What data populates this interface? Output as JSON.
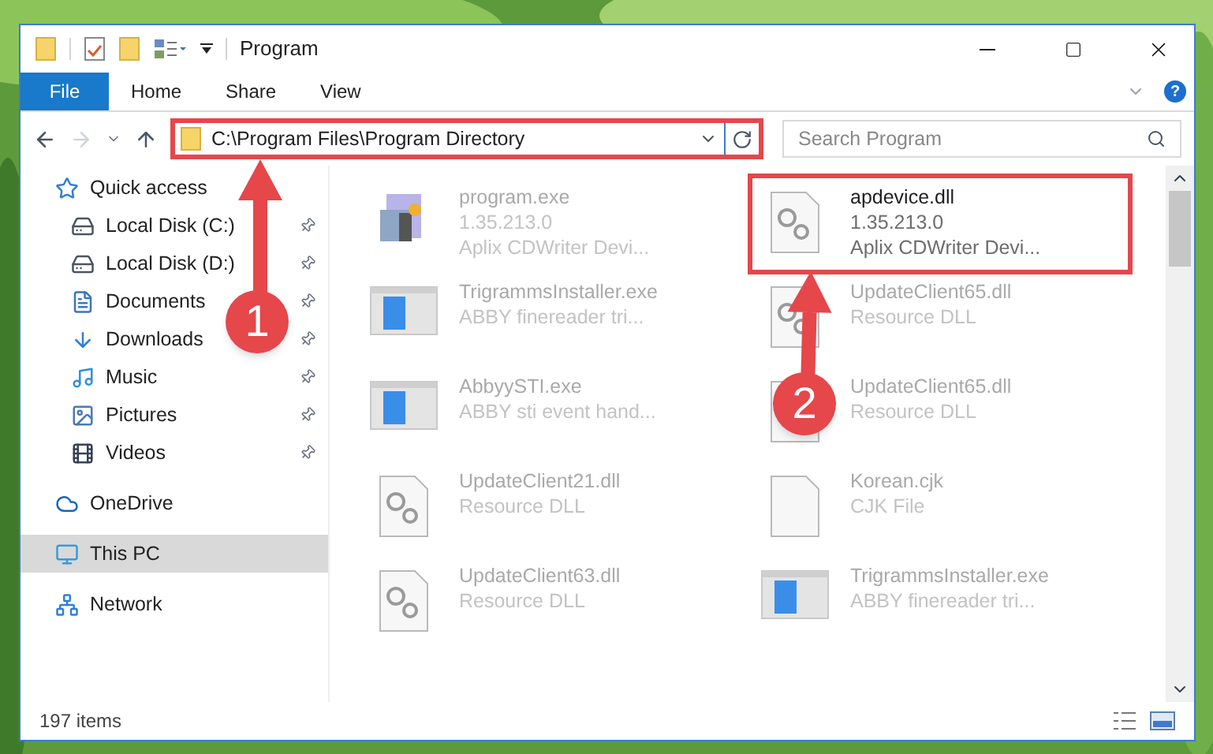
{
  "window": {
    "title": "Program"
  },
  "ribbon": {
    "tabs": [
      {
        "label": "File",
        "selected": true
      },
      {
        "label": "Home",
        "selected": false
      },
      {
        "label": "Share",
        "selected": false
      },
      {
        "label": "View",
        "selected": false
      }
    ],
    "help": "?"
  },
  "address_bar": {
    "path": "C:\\Program Files\\Program Directory"
  },
  "search": {
    "placeholder": "Search Program"
  },
  "sidebar": {
    "items": [
      {
        "label": "Quick access",
        "kind": "quick",
        "pinned": false,
        "selected": false
      },
      {
        "label": "Local Disk (C:)",
        "kind": "diskc",
        "pinned": true,
        "selected": false
      },
      {
        "label": "Local Disk (D:)",
        "kind": "disk",
        "pinned": true,
        "selected": false
      },
      {
        "label": "Documents",
        "kind": "docs",
        "pinned": true,
        "selected": false
      },
      {
        "label": "Downloads",
        "kind": "down",
        "pinned": true,
        "selected": false
      },
      {
        "label": "Music",
        "kind": "music",
        "pinned": true,
        "selected": false
      },
      {
        "label": "Pictures",
        "kind": "pics",
        "pinned": true,
        "selected": false
      },
      {
        "label": "Videos",
        "kind": "video",
        "pinned": true,
        "selected": false
      },
      {
        "label": "OneDrive",
        "kind": "cloud",
        "pinned": false,
        "selected": false
      },
      {
        "label": "This PC",
        "kind": "pc",
        "pinned": false,
        "selected": true
      },
      {
        "label": "Network",
        "kind": "net",
        "pinned": false,
        "selected": false
      }
    ]
  },
  "files": [
    {
      "name": "program.exe",
      "lines": [
        "1.35.213.0",
        "Aplix CDWriter Devi..."
      ],
      "kind": "setup",
      "highlighted": false
    },
    {
      "name": "apdevice.dll",
      "lines": [
        "1.35.213.0",
        "Aplix CDWriter Devi..."
      ],
      "kind": "dll",
      "highlighted": true
    },
    {
      "name": "TrigrammsInstaller.exe",
      "lines": [
        "ABBY finereader tri..."
      ],
      "kind": "exe",
      "highlighted": false
    },
    {
      "name": "UpdateClient65.dll",
      "lines": [
        "Resource DLL"
      ],
      "kind": "dll",
      "highlighted": false
    },
    {
      "name": "AbbyySTI.exe",
      "lines": [
        "ABBY sti event hand..."
      ],
      "kind": "exe",
      "highlighted": false
    },
    {
      "name": "UpdateClient65.dll",
      "lines": [
        "Resource DLL"
      ],
      "kind": "dll",
      "highlighted": false
    },
    {
      "name": "UpdateClient21.dll",
      "lines": [
        "Resource DLL"
      ],
      "kind": "dll",
      "highlighted": false
    },
    {
      "name": "Korean.cjk",
      "lines": [
        "CJK File"
      ],
      "kind": "blank",
      "highlighted": false
    },
    {
      "name": "UpdateClient63.dll",
      "lines": [
        "Resource DLL"
      ],
      "kind": "dll",
      "highlighted": false
    },
    {
      "name": "TrigrammsInstaller.exe",
      "lines": [
        "ABBY finereader tri..."
      ],
      "kind": "exe",
      "highlighted": false
    }
  ],
  "annotations": [
    {
      "number": "1"
    },
    {
      "number": "2"
    }
  ],
  "status_bar": {
    "count": "197 items"
  }
}
